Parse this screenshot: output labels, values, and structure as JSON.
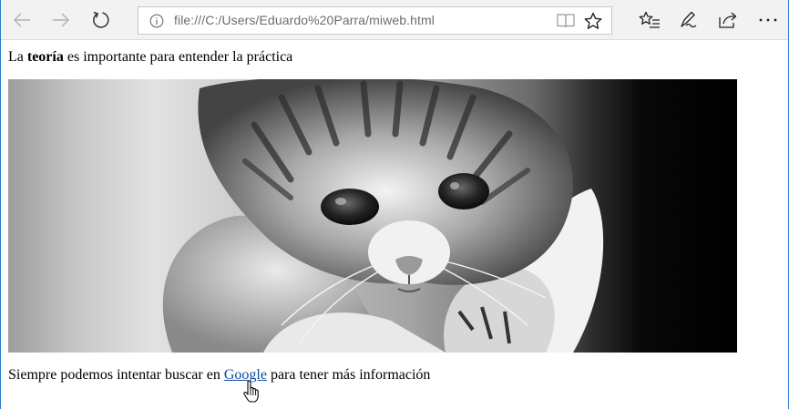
{
  "browser": {
    "url": "file:///C:/Users/Eduardo%20Parra/miweb.html",
    "icons": {
      "back": "arrow-left-icon",
      "forward": "arrow-right-icon",
      "refresh": "refresh-icon",
      "info": "info-icon",
      "reading_view": "reading-view-icon",
      "favorite": "star-icon",
      "hub": "favorites-hub-icon",
      "notes": "pen-icon",
      "share": "share-icon",
      "more": "more-icon"
    }
  },
  "page": {
    "para1": {
      "before": "La ",
      "bold": "teoría",
      "after": " es importante para entender la práctica"
    },
    "para2": {
      "before": "Siempre podemos intentar buscar en ",
      "link": "Google",
      "after": " para tener más información"
    }
  },
  "colors": {
    "toolbar_bg": "#f2f2f2",
    "link": "#0c4da2",
    "frame": "#2b7cd3"
  }
}
